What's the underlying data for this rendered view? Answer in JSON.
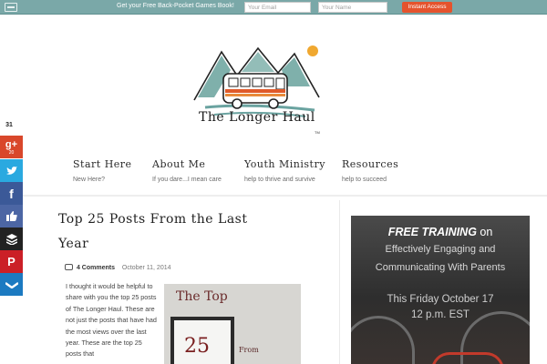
{
  "optin": {
    "text": "Get your Free Back-Pocket Games Book!",
    "email_placeholder": "Your Email",
    "name_placeholder": "Your Name",
    "button_label": "Instant Access",
    "accent_color": "#e5532d"
  },
  "logo": {
    "title": "The Longer Haul",
    "tm": "TM"
  },
  "nav": [
    {
      "title": "Start Here",
      "sub": "New Here?"
    },
    {
      "title": "About Me",
      "sub": "If you dare...I mean care"
    },
    {
      "title": "Youth Ministry",
      "sub": "help to thrive and survive"
    },
    {
      "title": "Resources",
      "sub": "help to succeed"
    }
  ],
  "social": {
    "share_count": "31",
    "gplus_count": "20",
    "icons": [
      "google-plus-icon",
      "twitter-icon",
      "facebook-icon",
      "like-icon",
      "buffer-icon",
      "pinterest-icon",
      "sumome-icon"
    ]
  },
  "post": {
    "title": "Top 25 Posts From the Last Year",
    "comments": "4 Comments",
    "date": "October 11, 2014",
    "body": "I thought it would be helpful to share with you the top 25 posts of The Longer Haul.  These are not just the posts that have had the most views over the last year.  These are the top 25 posts that",
    "image_text_top": "The Top",
    "image_number": "25",
    "image_from": "From"
  },
  "promo": {
    "free_training": "FREE TRAINING",
    "on": "on",
    "line2": "Effectively Engaging and",
    "line3": "Communicating With Parents",
    "line4": "This Friday October 17",
    "line5": "12 p.m. EST"
  }
}
